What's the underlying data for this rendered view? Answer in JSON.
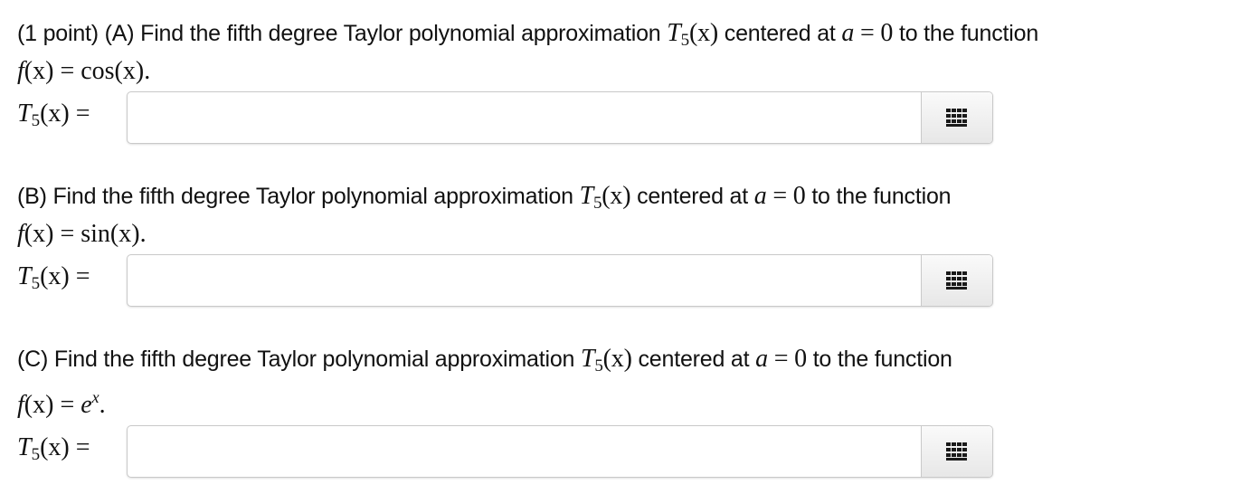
{
  "problems": [
    {
      "intro": "(1 point) (A) Find the fifth degree Taylor polynomial approximation",
      "centered": "centered at",
      "to_function": "to the function",
      "func": "cos(x)",
      "input_value": ""
    },
    {
      "intro": "(B) Find the fifth degree Taylor polynomial approximation",
      "centered": "centered at",
      "to_function": "to the function",
      "func": "sin(x)",
      "input_value": ""
    },
    {
      "intro": "(C) Find the fifth degree Taylor polynomial approximation",
      "centered": "centered at",
      "to_function": "to the function",
      "func_base": "e",
      "func_exp": "x",
      "input_value": ""
    }
  ],
  "math": {
    "T": "T",
    "sub5": "5",
    "x_arg": "(x)",
    "a": "a",
    "eq_zero": " = 0",
    "f": "f",
    "equals": " = ",
    "period": ".",
    "answer_equals": " ="
  },
  "icons": {
    "equation_button": "keypad-grid-icon"
  },
  "colors": {
    "text": "#111111",
    "input_border": "#c9c9c9",
    "button_bg": "#ececec",
    "icon": "#1a1a1a"
  }
}
